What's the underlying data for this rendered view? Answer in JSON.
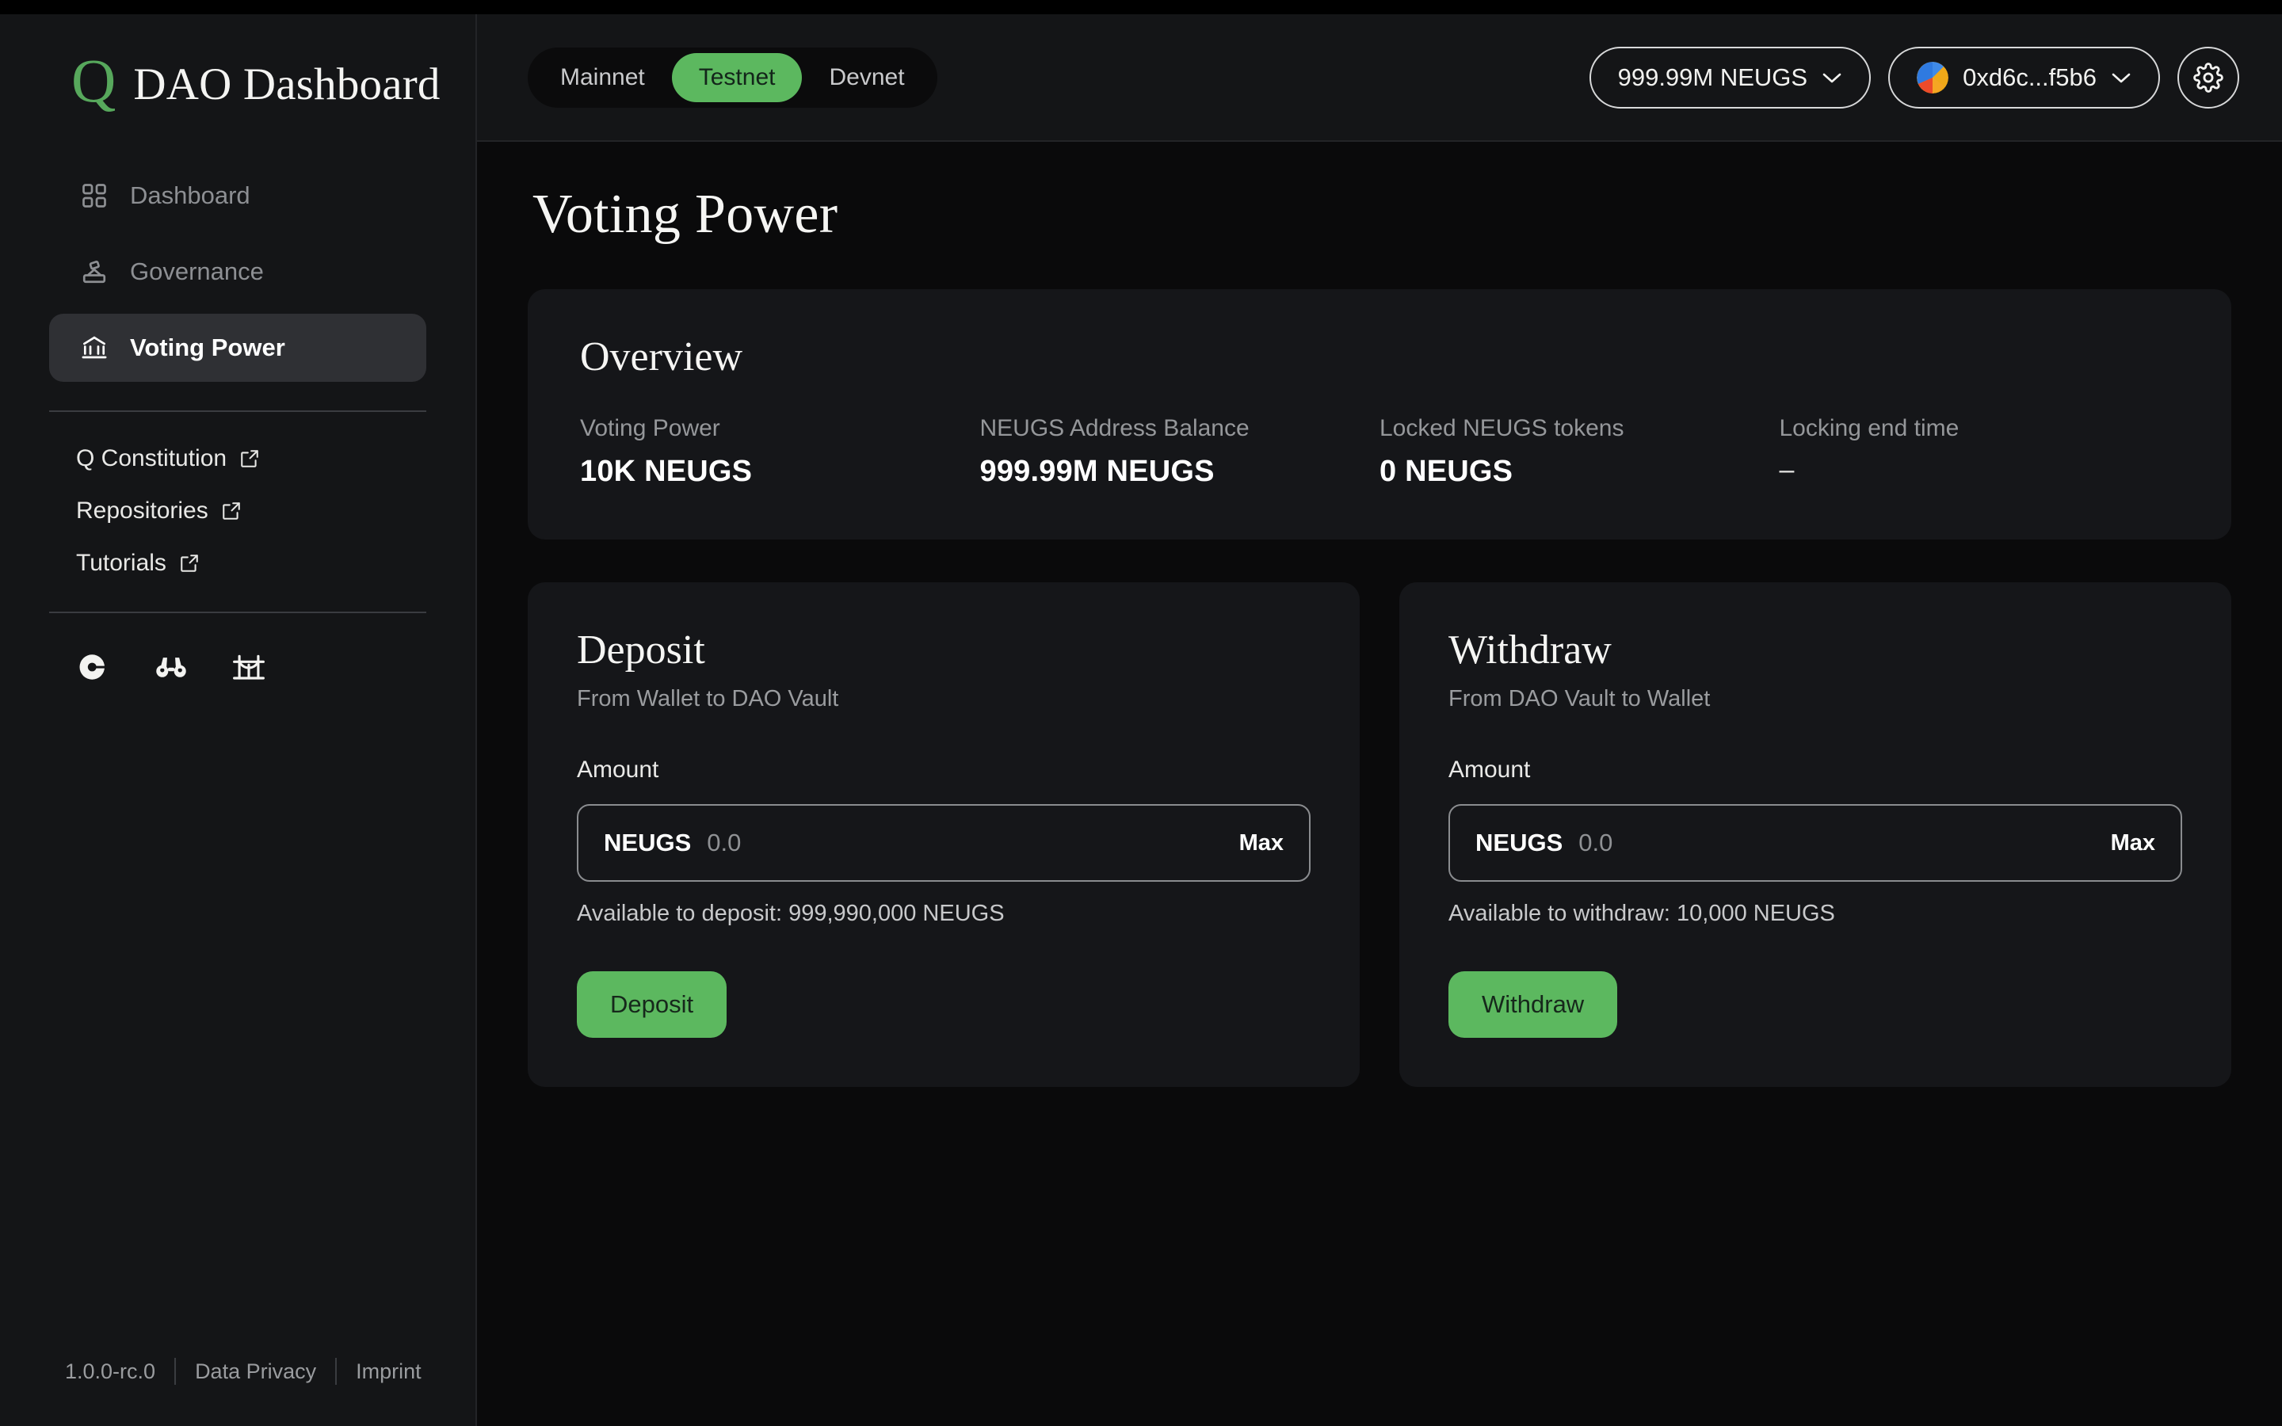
{
  "brand": {
    "logo_letter": "Q",
    "title": "DAO Dashboard"
  },
  "sidebar": {
    "nav": [
      {
        "label": "Dashboard",
        "icon": "grid-icon",
        "active": false
      },
      {
        "label": "Governance",
        "icon": "ballot-box-icon",
        "active": false
      },
      {
        "label": "Voting Power",
        "icon": "bank-icon",
        "active": true
      }
    ],
    "external_links": [
      {
        "label": "Q Constitution",
        "icon": "external-link-icon"
      },
      {
        "label": "Repositories",
        "icon": "external-link-icon"
      },
      {
        "label": "Tutorials",
        "icon": "external-link-icon"
      }
    ],
    "socials": [
      {
        "icon": "q-logo-icon"
      },
      {
        "icon": "binoculars-icon"
      },
      {
        "icon": "bridge-icon"
      }
    ]
  },
  "footer": {
    "version": "1.0.0-rc.0",
    "data_privacy": "Data Privacy",
    "imprint": "Imprint"
  },
  "header": {
    "networks": [
      {
        "label": "Mainnet",
        "active": false
      },
      {
        "label": "Testnet",
        "active": true
      },
      {
        "label": "Devnet",
        "active": false
      }
    ],
    "balance_pill": {
      "label": "999.99M NEUGS",
      "chevron": "chevron-down-icon"
    },
    "account_pill": {
      "label": "0xd6c...f5b6",
      "chevron": "chevron-down-icon",
      "avatar": "account-avatar"
    },
    "settings_icon": "gear-icon"
  },
  "page": {
    "title": "Voting Power"
  },
  "overview": {
    "title": "Overview",
    "stats": [
      {
        "label": "Voting Power",
        "value": "10K NEUGS"
      },
      {
        "label": "NEUGS Address Balance",
        "value": "999.99M NEUGS"
      },
      {
        "label": "Locked NEUGS tokens",
        "value": "0 NEUGS"
      },
      {
        "label": "Locking end time",
        "value": "–"
      }
    ]
  },
  "deposit": {
    "title": "Deposit",
    "subtitle": "From Wallet to DAO Vault",
    "amount_label": "Amount",
    "token": "NEUGS",
    "placeholder": "0.0",
    "max_label": "Max",
    "available": "Available to deposit: 999,990,000 NEUGS",
    "button": "Deposit"
  },
  "withdraw": {
    "title": "Withdraw",
    "subtitle": "From DAO Vault to Wallet",
    "amount_label": "Amount",
    "token": "NEUGS",
    "placeholder": "0.0",
    "max_label": "Max",
    "available": "Available to withdraw: 10,000 NEUGS",
    "button": "Withdraw"
  },
  "colors": {
    "accent_green": "#5cb85f",
    "logo_green": "#57a85c",
    "page_bg": "#0a0a0b",
    "panel_bg": "#141517",
    "card_bg": "#151619",
    "active_nav_bg": "#2f3034"
  }
}
